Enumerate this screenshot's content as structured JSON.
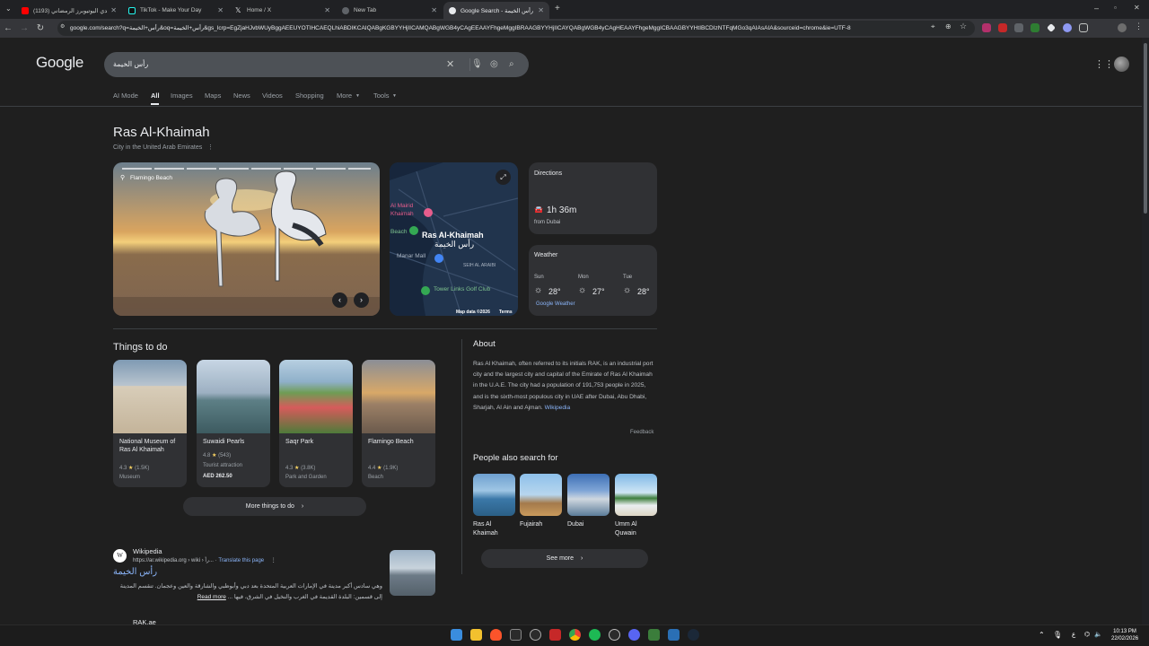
{
  "browser": {
    "tabs": [
      {
        "title": "(1193) تحدي اليوتيوبرز الرمضاني",
        "color": "#ff0000"
      },
      {
        "title": "TikTok - Make Your Day",
        "color": "#111111"
      },
      {
        "title": "Home / X",
        "color": "#000000"
      },
      {
        "title": "New Tab",
        "color": "#5f6368"
      },
      {
        "title": "Google Search - رأس الخيمة",
        "color": "#4285f4"
      }
    ],
    "url": "google.com/search?q=رأس+الخيمة&oq=رأس+الخيمة&gs_lcrp=EgZjaHJvbWUyBggAEEUYOTIHCAEQLhiABDIKCAIQABgKGBYYHjIICAMQABgWGB4yCAgEEAAYFhgeMggIBRAAGBYYHjIICAYQABgWGB4yCAgHEAAYFhgeMggICBAAGBYYHtIBCDIzNTFqMGo3qAIAsAIA&sourceid=chrome&ie=UTF-8"
  },
  "google": {
    "logo": "Google",
    "query": "رأس الخيمة",
    "tabs": [
      "AI Mode",
      "All",
      "Images",
      "Maps",
      "News",
      "Videos",
      "Shopping",
      "More",
      "Tools"
    ]
  },
  "panel": {
    "title": "Ras Al-Khaimah",
    "subtitle": "City in the United Arab Emirates",
    "photo_caption": "Flamingo Beach",
    "map": {
      "label_en": "Ras Al-Khaimah",
      "label_ar": "رأس الخيمة",
      "places": [
        "Al Mairid",
        "Khaimah",
        "Beach",
        "Manar Mall",
        "SEIH AL ARAIBI",
        "Tower Links Golf Club"
      ],
      "footer": "Map data ©2026",
      "terms": "Terms"
    },
    "directions": {
      "heading": "Directions",
      "time": "1h 36m",
      "from": "from Dubai"
    },
    "weather": {
      "heading": "Weather",
      "days": [
        {
          "day": "Sun",
          "temp": "28°"
        },
        {
          "day": "Mon",
          "temp": "27°"
        },
        {
          "day": "Tue",
          "temp": "28°"
        }
      ],
      "source": "Google Weather"
    }
  },
  "things_to_do": {
    "title": "Things to do",
    "items": [
      {
        "name": "National Museum of Ras Al Khaimah",
        "rating": "4.3",
        "reviews": "(1.5K)",
        "type": "Museum",
        "price": ""
      },
      {
        "name": "Suwaidi Pearls",
        "rating": "4.8",
        "reviews": "(543)",
        "type": "Tourist attraction",
        "price": "AED 262.50"
      },
      {
        "name": "Saqr Park",
        "rating": "4.3",
        "reviews": "(3.8K)",
        "type": "Park and Garden",
        "price": ""
      },
      {
        "name": "Flamingo Beach",
        "rating": "4.4",
        "reviews": "(1.9K)",
        "type": "Beach",
        "price": ""
      }
    ],
    "more": "More things to do"
  },
  "about": {
    "title": "About",
    "text": "Ras Al Khaimah, often referred to its initials RAK, is an industrial port city and the largest city and capital of the Emirate of Ras Al Khaimah in the U.A.E. The city had a population of 191,753 people in 2025, and is the sixth-most populous city in UAE after Dubai, Abu Dhabi, Sharjah, Al Ain and Ajman.",
    "source": "Wikipedia",
    "feedback": "Feedback"
  },
  "people_also_search": {
    "title": "People also search for",
    "items": [
      "Ras Al Khaimah",
      "Fujairah",
      "Dubai",
      "Umm Al Quwain"
    ],
    "see_more": "See more"
  },
  "result": {
    "site": "Wikipedia",
    "url": "https://ar.wikipedia.org › wiki › رأ...",
    "translate": "Translate this page",
    "title": "رأس الخيمة",
    "snippet": "وهي سادس أكبر مدينة في الإمارات العربية المتحدة بعد دبي وأبوظبي والشارقة والعين وعجمان. تنقسم المدينة إلى قسمين: البلدة القديمة في الغرب والنخيل في الشرق، فيها ...",
    "read_more": "Read more",
    "next_site": "RAK.ae"
  },
  "taskbar": {
    "lang": "ع",
    "time": "10:13 PM",
    "date": "22/02/2026"
  }
}
